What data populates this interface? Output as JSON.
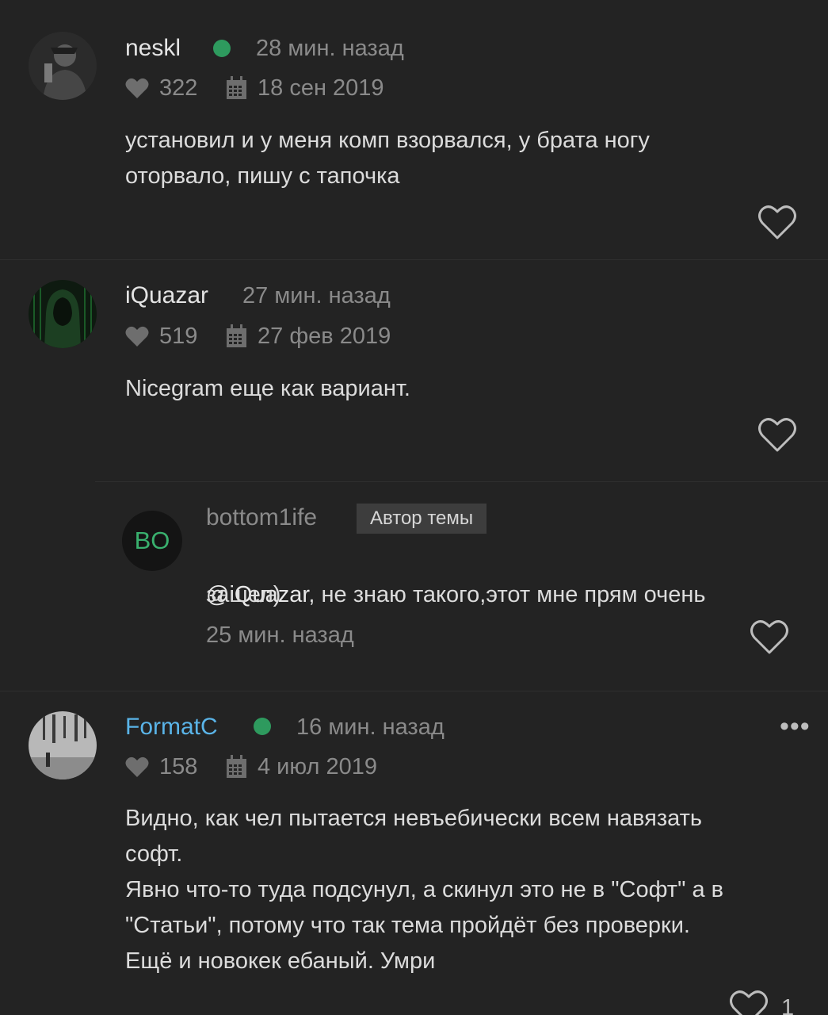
{
  "comments": [
    {
      "username": "neskl",
      "online": true,
      "time": "28 мин. назад",
      "likes": "322",
      "date": "18 сен 2019",
      "text": "установил и у меня комп взорвался, у брата ногу\nоторвало, пишу с тапочка"
    },
    {
      "username": "iQuazar",
      "online": false,
      "time": "27 мин. назад",
      "likes": "519",
      "date": "27 фев 2019",
      "text": "Nicegram еще как вариант.",
      "reply": {
        "avatar_initials": "BO",
        "username": "bottom1ife",
        "badge": "Автор темы",
        "mention": "@iQuazar",
        "text_after_mention": ", не знаю такого,этот мне прям очень",
        "text_line2": "зашел)",
        "time": "25 мин. назад"
      }
    },
    {
      "username": "FormatC",
      "online": true,
      "time": "16 мин. назад",
      "likes": "158",
      "date": "4 июл 2019",
      "text": "Видно, как чел пытается невъебически всем навязать\nсофт.\nЯвно что-то туда подсунул, а скинул это не в \"Софт\" а в\n\"Статьи\", потому что так тема пройдёт без проверки.\nЕщё и новокек ебаный. Умри",
      "like_count": "1",
      "more_label": "•••"
    }
  ],
  "colors": {
    "background": "#232323",
    "online": "#2e9a5e",
    "username_highlight": "#5ab4e8",
    "avatar_initials": "#39b06e"
  },
  "icons": {
    "heart": "heart-icon",
    "calendar": "calendar-icon",
    "like": "heart-outline-icon",
    "more": "more-horizontal-icon"
  }
}
